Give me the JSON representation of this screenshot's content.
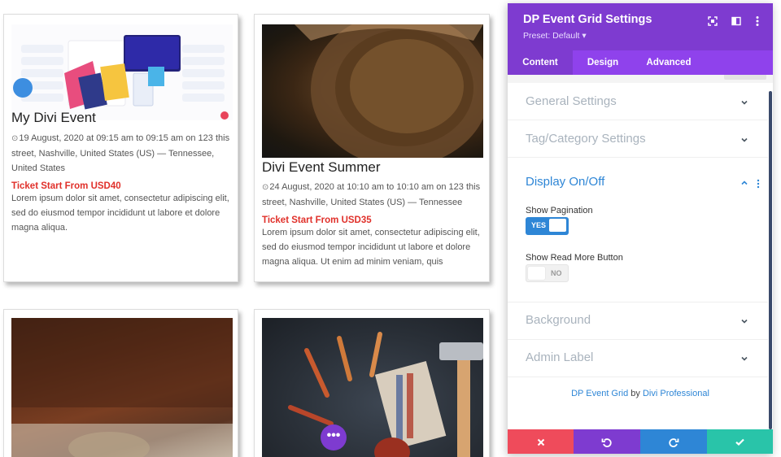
{
  "cards": [
    {
      "title": "My Divi Event",
      "meta": "19 August, 2020 at 09:15 am to 09:15 am on 123 this street, Nashville, United States (US) — Tennessee, United States",
      "ticket": "Ticket Start From USD40",
      "desc": "Lorem ipsum dolor sit amet, consectetur adipiscing elit, sed do eiusmod tempor incididunt ut labore et dolore magna aliqua."
    },
    {
      "title": "Divi Event Summer",
      "meta": "24 August, 2020 at 10:10 am to 10:10 am on 123 this street, Nashville, United States (US) — Tennessee",
      "ticket": "Ticket Start From USD35",
      "desc": "Lorem ipsum dolor sit amet, consectetur adipiscing elit, sed do eiusmod tempor incididunt ut labore et dolore magna aliqua. Ut enim ad minim veniam, quis"
    }
  ],
  "panel": {
    "title": "DP Event Grid Settings",
    "preset": "Preset: Default",
    "preset_caret": "▾",
    "tabs": [
      "Content",
      "Design",
      "Advanced"
    ],
    "sections": {
      "general": "General Settings",
      "tag_category": "Tag/Category Settings",
      "display": "Display On/Off",
      "background": "Background",
      "admin_label": "Admin Label"
    },
    "options": {
      "show_pagination_label": "Show Pagination",
      "show_pagination_value": "YES",
      "show_read_more_label": "Show Read More Button",
      "show_read_more_value": "NO"
    },
    "credit": {
      "module": "DP Event Grid",
      "by": "by",
      "author": "Divi Professional"
    }
  },
  "colors": {
    "header": "#7e3bd0",
    "tabs": "#8f42ec",
    "accent_blue": "#2e86d6",
    "ticket_red": "#e0302a",
    "cancel": "#ef4b5b",
    "undo": "#7e3bd0",
    "redo": "#2e86d6",
    "save": "#29c4a9"
  },
  "icons": {
    "expand": "expand-icon",
    "columns": "columns-icon",
    "more": "kebab-icon"
  }
}
